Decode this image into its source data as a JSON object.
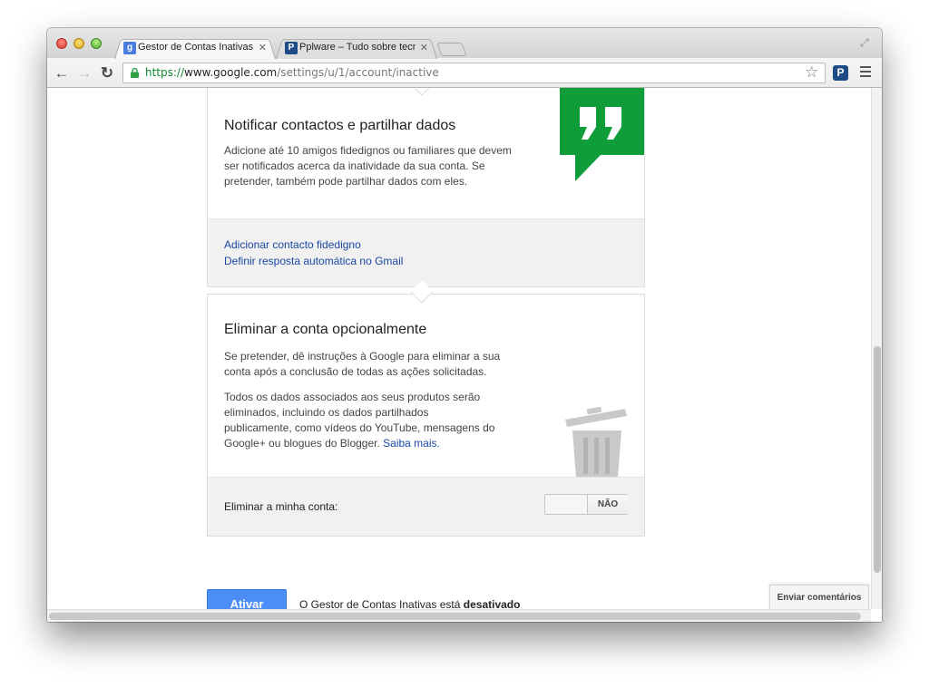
{
  "browser": {
    "tabs": [
      {
        "title": "Gestor de Contas Inativas",
        "favicon": "google-g-icon",
        "favicon_color": "#4a7cdb",
        "active": true
      },
      {
        "title": "Pplware – Tudo sobre tecn",
        "favicon": "pplware-p-icon",
        "favicon_color": "#1c4b85",
        "active": false
      }
    ],
    "url": {
      "scheme": "https://",
      "host": "www.google.com",
      "path": "/settings/u/1/account/inactive"
    },
    "extension_letter": "P"
  },
  "notify_card": {
    "title": "Notificar contactos e partilhar dados",
    "description": "Adicione até 10 amigos fidedignos ou familiares que devem ser notificados acerca da inatividade da sua conta. Se pretender, também pode partilhar dados com eles.",
    "link_add_contact": "Adicionar contacto fidedigno",
    "link_auto_reply": "Definir resposta automática no Gmail",
    "icon": "quote-bubble-icon",
    "icon_color": "#0f9d3a"
  },
  "delete_card": {
    "title": "Eliminar a conta opcionalmente",
    "paragraph1": "Se pretender, dê instruções à Google para eliminar a sua conta após a conclusão de todas as ações solicitadas.",
    "paragraph2": "Todos os dados associados aos seus produtos serão eliminados, incluindo os dados partilhados publicamente, como vídeos do YouTube, mensagens do Google+ ou blogues do Blogger.",
    "learn_more": "Saiba mais.",
    "icon": "trash-can-icon",
    "toggle_label": "Eliminar a minha conta:",
    "toggle_state": "NÃO"
  },
  "footer": {
    "activate_button": "Ativar",
    "status_prefix": "O Gestor de Contas Inativas está",
    "status_value": "desativado",
    "feedback_button": "Enviar comentários"
  },
  "colors": {
    "primary_button": "#4d8ef6",
    "link": "#1a47a8",
    "secure_scheme": "#0b8a2c"
  }
}
